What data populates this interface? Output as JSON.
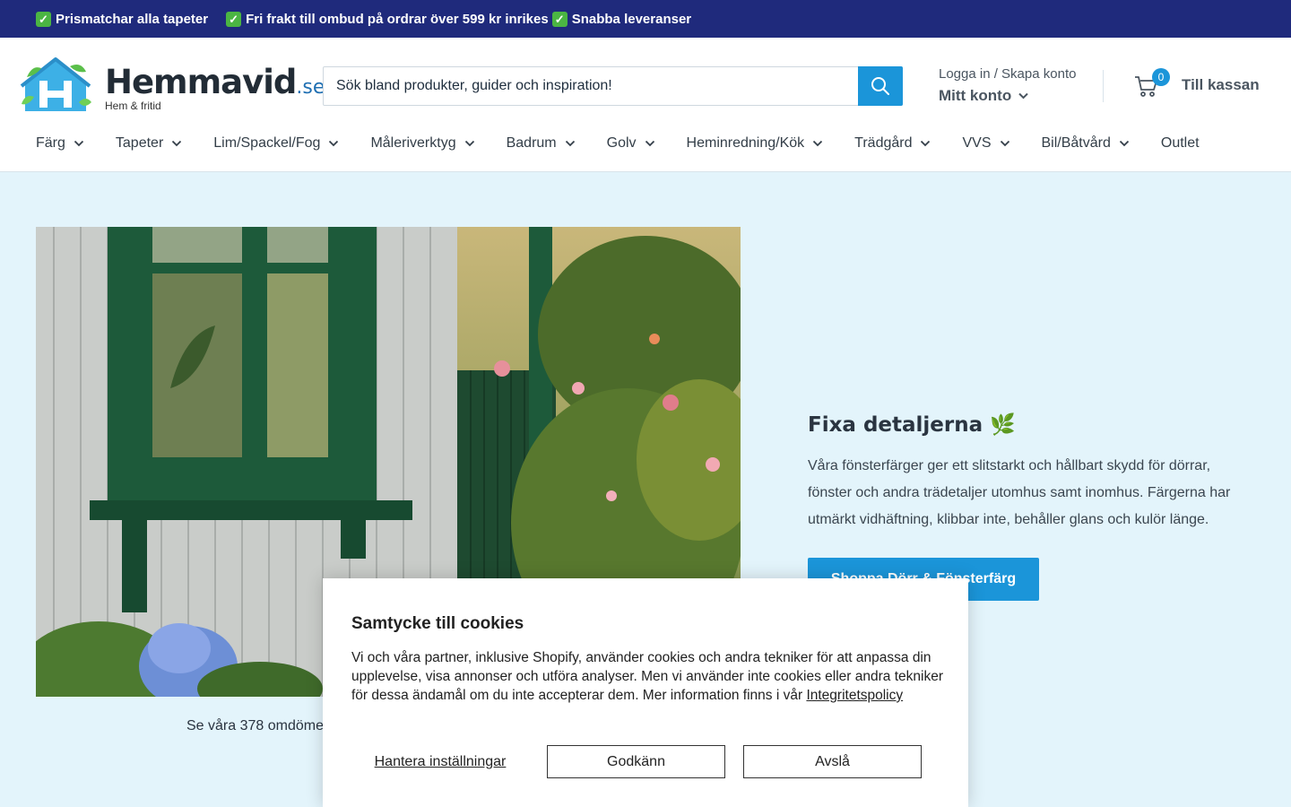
{
  "announcement": {
    "items": [
      "Prismatchar alla tapeter",
      "Fri frakt till ombud på ordrar över 599 kr inrikes",
      "Snabba leveranser"
    ],
    "check_icon": "check-mark-icon"
  },
  "logo": {
    "name": "Hemmavid",
    "tld": ".se",
    "tagline": "Hem & fritid"
  },
  "search": {
    "placeholder": "Sök bland produkter, guider och inspiration!",
    "button_icon": "search-icon"
  },
  "account": {
    "login_label": "Logga in / Skapa konto",
    "my_account_label": "Mitt konto"
  },
  "cart": {
    "count": "0",
    "label": "Till kassan"
  },
  "nav": {
    "items": [
      {
        "label": "Färg",
        "has_dropdown": true
      },
      {
        "label": "Tapeter",
        "has_dropdown": true
      },
      {
        "label": "Lim/Spackel/Fog",
        "has_dropdown": true
      },
      {
        "label": "Måleriverktyg",
        "has_dropdown": true
      },
      {
        "label": "Badrum",
        "has_dropdown": true
      },
      {
        "label": "Golv",
        "has_dropdown": true
      },
      {
        "label": "Heminredning/Kök",
        "has_dropdown": true
      },
      {
        "label": "Trädgård",
        "has_dropdown": true
      },
      {
        "label": "VVS",
        "has_dropdown": true
      },
      {
        "label": "Bil/Båtvård",
        "has_dropdown": true
      },
      {
        "label": "Outlet",
        "has_dropdown": false
      }
    ]
  },
  "hero": {
    "title": "Fixa detaljerna 🌿",
    "text": "Våra fönsterfärger ger ett slitstarkt och hållbart skydd för dörrar, fönster och andra trädetaljer utomhus samt inomhus. Färgerna har utmärkt vidhäftning, klibbar inte, behåller glans och kulör länge.",
    "button_label": "Shoppa Dörr & Fönsterfärg",
    "reviews_text": "Se våra 378 omdöme"
  },
  "cookie": {
    "title": "Samtycke till cookies",
    "body": "Vi och våra partner, inklusive Shopify, använder cookies och andra tekniker för att anpassa din upplevelse, visa annonser och utföra analyser. Men vi använder inte cookies eller andra tekniker för dessa ändamål om du inte accepterar dem. Mer information finns i vår",
    "policy_link": "Integritetspolicy",
    "manage_label": "Hantera inställningar",
    "accept_label": "Godkänn",
    "decline_label": "Avslå"
  },
  "colors": {
    "announcement_bg": "#1f2a7c",
    "accent": "#1b95d9",
    "page_bg": "#e3f4fb",
    "window_green": "#1d5a3a"
  }
}
